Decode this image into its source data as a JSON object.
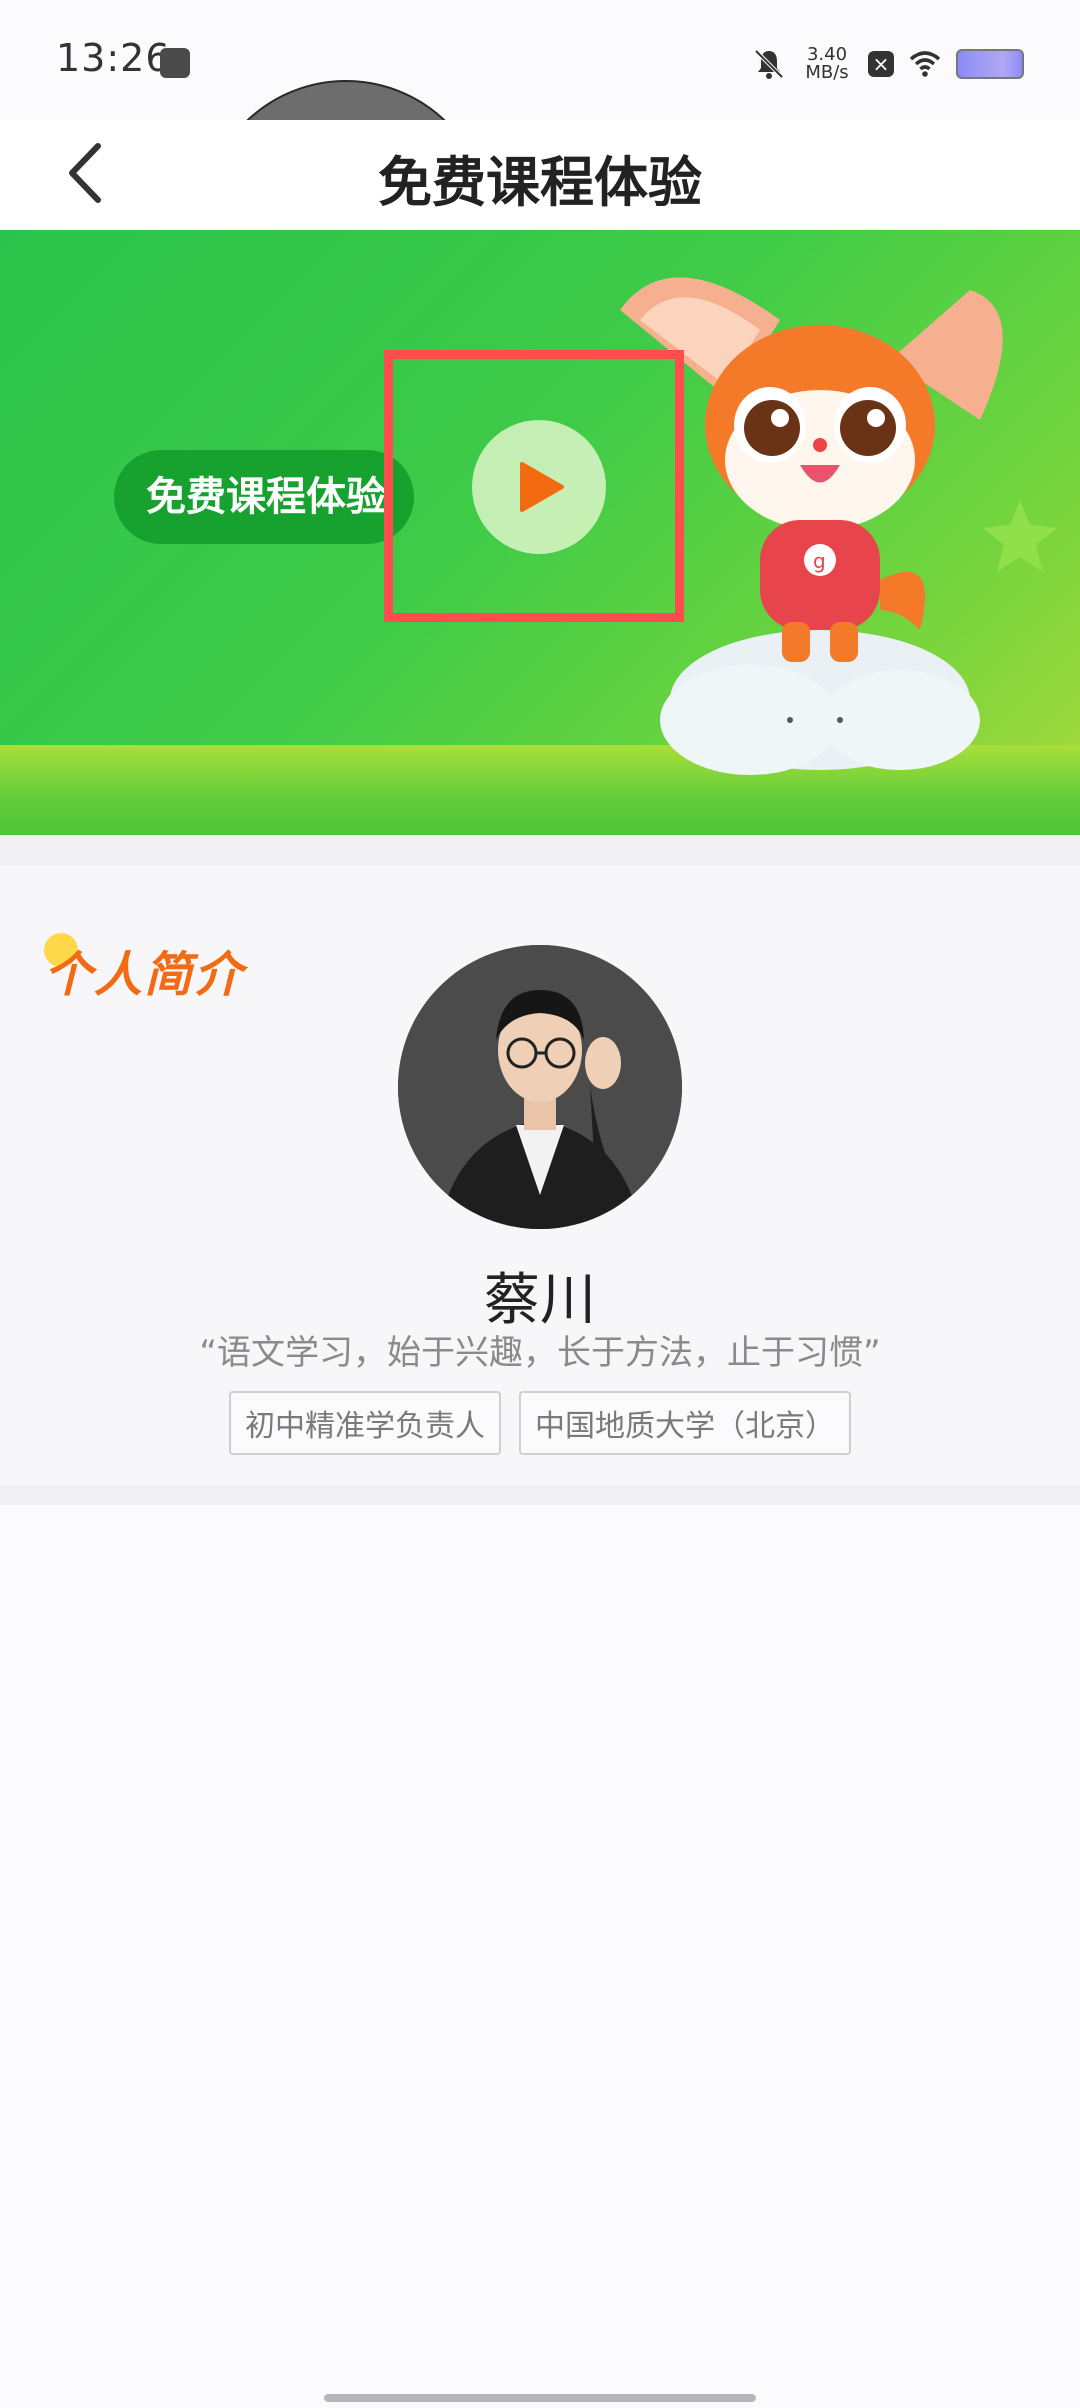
{
  "status_bar": {
    "time": "13:26",
    "network_speed": "3.40\nMB/s"
  },
  "header": {
    "title": "免费课程体验"
  },
  "banner": {
    "pill_label": "免费课程体验"
  },
  "profile": {
    "section_title": "个人简介",
    "teacher_name": "蔡川",
    "quote": "“语文学习，始于兴趣，长于方法，止于习惯”",
    "tags": [
      "初中精准学负责人",
      "中国地质大学（北京）"
    ]
  },
  "colors": {
    "brand_green": "#2cc34c",
    "highlight_red": "#ff4d4d",
    "accent_orange": "#f26a14"
  }
}
